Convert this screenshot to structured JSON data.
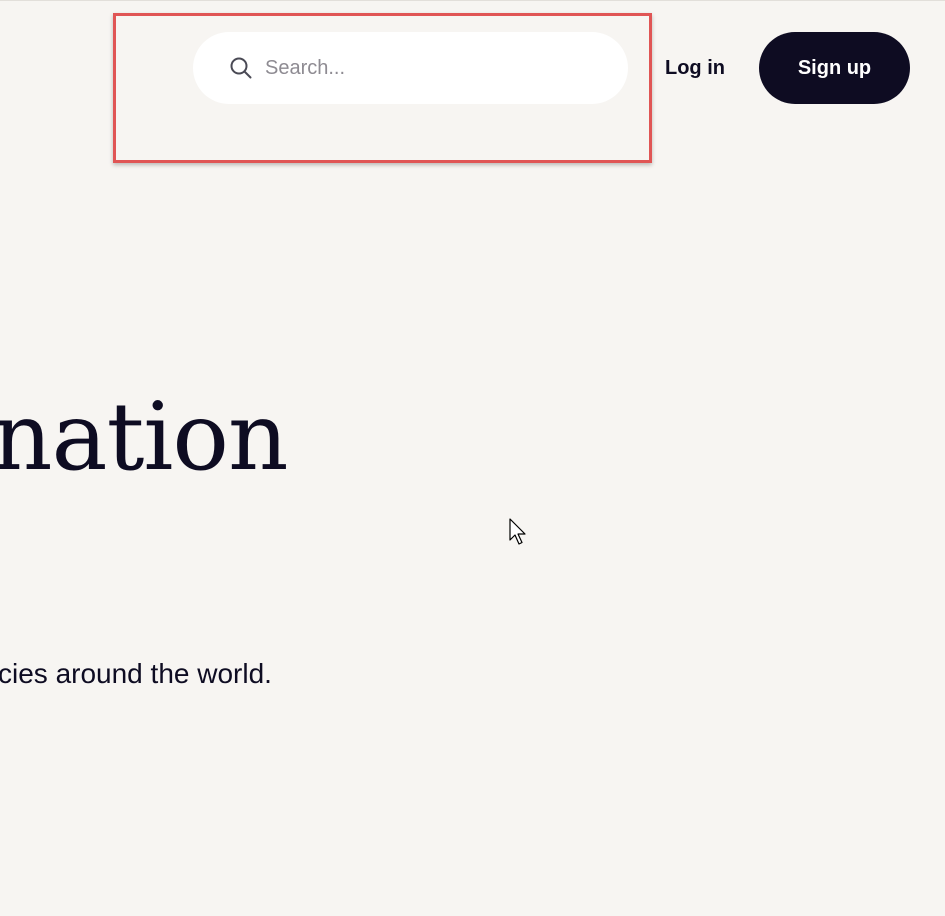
{
  "header": {
    "search": {
      "icon": "search-icon",
      "placeholder": "Search..."
    },
    "login_label": "Log in",
    "signup_label": "Sign up"
  },
  "hero": {
    "title": "nation",
    "subtitle": "cies around the world."
  },
  "colors": {
    "background": "#f7f5f2",
    "primary_dark": "#0e0c22",
    "search_bg": "#ffffff",
    "highlight": "#e05555"
  },
  "annotation": {
    "highlight": "red-rectangle"
  },
  "cursor": {
    "icon": "mouse-pointer-icon"
  }
}
